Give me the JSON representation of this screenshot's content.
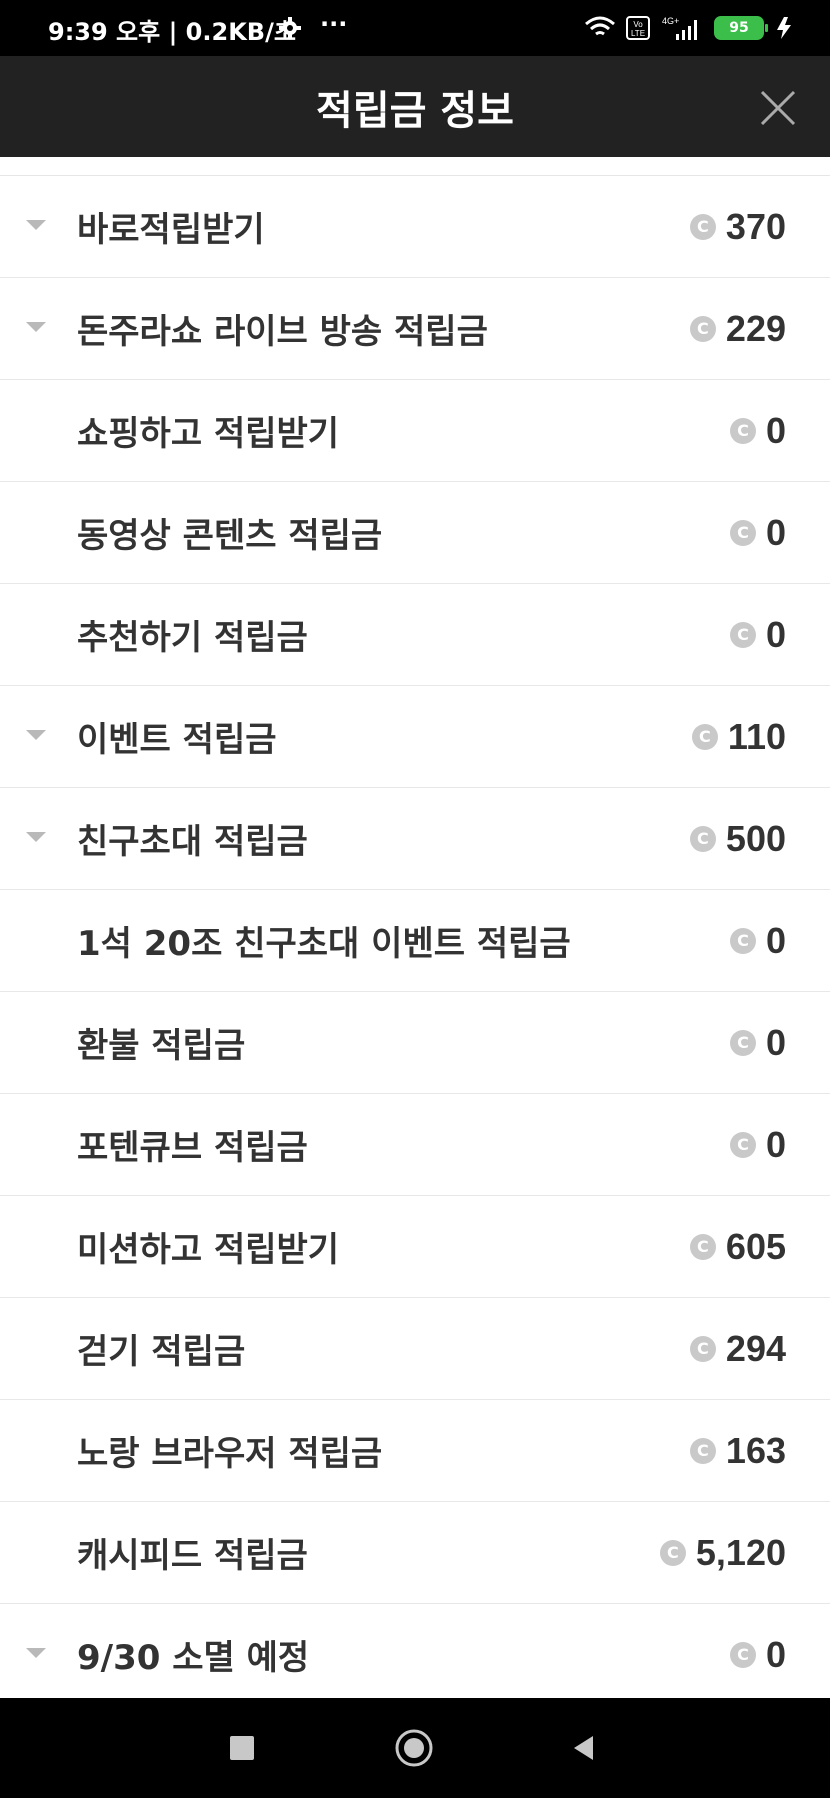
{
  "status_bar": {
    "time": "9:39 오후 | 0.2KB/초",
    "battery": "95",
    "network": "4G+"
  },
  "header": {
    "title": "적립금 정보"
  },
  "items": [
    {
      "label": "바로적립받기",
      "value": "370",
      "has_caret": true
    },
    {
      "label": "돈주라쇼 라이브 방송 적립금",
      "value": "229",
      "has_caret": true
    },
    {
      "label": "쇼핑하고 적립받기",
      "value": "0",
      "has_caret": false
    },
    {
      "label": "동영상 콘텐츠 적립금",
      "value": "0",
      "has_caret": false
    },
    {
      "label": "추천하기 적립금",
      "value": "0",
      "has_caret": false
    },
    {
      "label": "이벤트 적립금",
      "value": "110",
      "has_caret": true
    },
    {
      "label": "친구초대 적립금",
      "value": "500",
      "has_caret": true
    },
    {
      "label": "1석 20조 친구초대 이벤트 적립금",
      "value": "0",
      "has_caret": false
    },
    {
      "label": "환불 적립금",
      "value": "0",
      "has_caret": false
    },
    {
      "label": "포텐큐브 적립금",
      "value": "0",
      "has_caret": false
    },
    {
      "label": "미션하고 적립받기",
      "value": "605",
      "has_caret": false
    },
    {
      "label": "걷기 적립금",
      "value": "294",
      "has_caret": false
    },
    {
      "label": "노랑 브라우저 적립금",
      "value": "163",
      "has_caret": false
    },
    {
      "label": "캐시피드 적립금",
      "value": "5,120",
      "has_caret": false
    },
    {
      "label": "9/30 소멸 예정",
      "value": "0",
      "has_caret": true
    }
  ],
  "coin_symbol": "C",
  "colors": {
    "header_bg": "#222222",
    "text": "#333333",
    "coin": "#c9c9c9",
    "caret": "#b9b9b9"
  }
}
